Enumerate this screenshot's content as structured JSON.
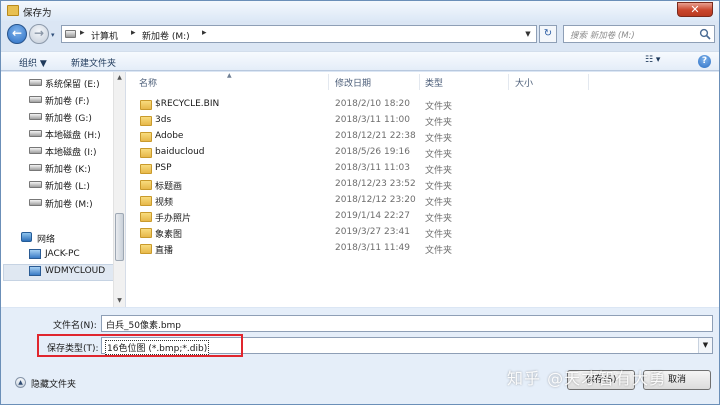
{
  "window": {
    "title": "保存为",
    "close_label": "✕"
  },
  "navigation": {
    "back_glyph": "←",
    "forward_glyph": "→",
    "breadcrumb_sep": "▸",
    "breadcrumb": [
      "计算机",
      "新加卷 (M:)"
    ],
    "refresh_glyph": "↻",
    "search_placeholder": "搜索 新加卷 (M:)"
  },
  "toolbar": {
    "organize": "组织 ▼",
    "new_folder": "新建文件夹",
    "view_glyph": "☷ ▾",
    "help": "?"
  },
  "sidebar": {
    "drives": [
      {
        "label": "系统保留 (E:)"
      },
      {
        "label": "新加卷 (F:)"
      },
      {
        "label": "新加卷 (G:)"
      },
      {
        "label": "本地磁盘 (H:)"
      },
      {
        "label": "本地磁盘 (I:)"
      },
      {
        "label": "新加卷 (K:)"
      },
      {
        "label": "新加卷 (L:)"
      },
      {
        "label": "新加卷 (M:)",
        "selected": true
      }
    ],
    "network": "网络",
    "network_items": [
      "JACK-PC",
      "WDMYCLOUD"
    ]
  },
  "file_list": {
    "columns": [
      "名称",
      "修改日期",
      "类型",
      "大小"
    ],
    "rows": [
      {
        "name": "$RECYCLE.BIN",
        "date": "2018/2/10 18:20",
        "type": "文件夹"
      },
      {
        "name": "3ds",
        "date": "2018/3/11 11:00",
        "type": "文件夹"
      },
      {
        "name": "Adobe",
        "date": "2018/12/21 22:38",
        "type": "文件夹"
      },
      {
        "name": "baiducloud",
        "date": "2018/5/26 19:16",
        "type": "文件夹"
      },
      {
        "name": "PSP",
        "date": "2018/3/11 11:03",
        "type": "文件夹"
      },
      {
        "name": "标题画",
        "date": "2018/12/23 23:52",
        "type": "文件夹"
      },
      {
        "name": "视频",
        "date": "2018/12/12 23:20",
        "type": "文件夹"
      },
      {
        "name": "手办照片",
        "date": "2019/1/14 22:27",
        "type": "文件夹"
      },
      {
        "name": "象素图",
        "date": "2019/3/27 23:41",
        "type": "文件夹"
      },
      {
        "name": "直播",
        "date": "2018/3/11 11:49",
        "type": "文件夹"
      }
    ]
  },
  "form": {
    "filename_label": "文件名(N):",
    "filename_value": "白兵_50像素.bmp",
    "filetype_label": "保存类型(T):",
    "filetype_value": "16色位图 (*.bmp;*.dib)",
    "hide_folders": "隐藏文件夹",
    "save_button": "保存(S)",
    "cancel_button": "取消"
  },
  "watermark": "知乎 @天才智有大勇",
  "colors": {
    "accent": "#2b6fc4",
    "highlight_box": "#e0262e",
    "folder": "#e7b84a"
  }
}
